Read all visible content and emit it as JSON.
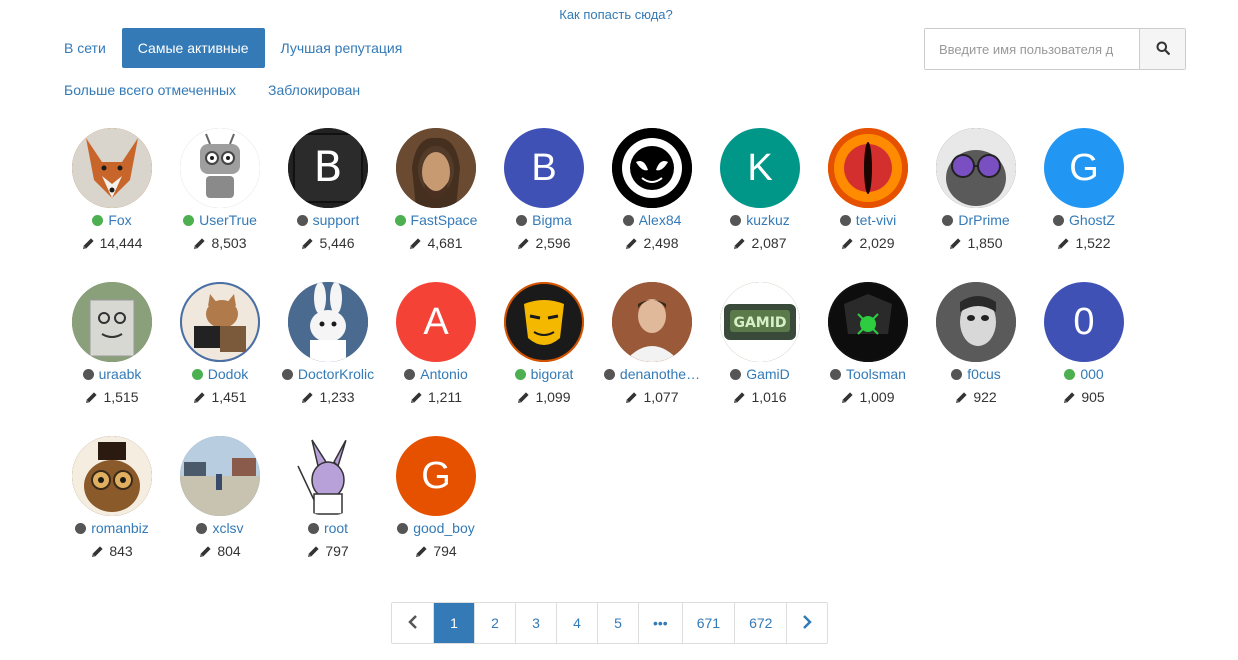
{
  "help_link": "Как попасть сюда?",
  "tabs": [
    {
      "label": "В сети",
      "active": false
    },
    {
      "label": "Самые активные",
      "active": true
    },
    {
      "label": "Лучшая репутация",
      "active": false
    },
    {
      "label": "Больше всего отмеченных",
      "active": false
    },
    {
      "label": "Заблокирован",
      "active": false
    }
  ],
  "search": {
    "placeholder": "Введите имя пользователя д"
  },
  "users": [
    {
      "name": "Fox",
      "online": true,
      "posts": "14,444",
      "avatar": {
        "type": "image",
        "icon": "fox-avatar",
        "color": "#b86a3a"
      }
    },
    {
      "name": "UserTrue",
      "online": true,
      "posts": "8,503",
      "avatar": {
        "type": "image",
        "icon": "robot-avatar",
        "color": "#9e9e9e"
      }
    },
    {
      "name": "support",
      "online": false,
      "posts": "5,446",
      "avatar": {
        "type": "image",
        "icon": "letter-b-avatar",
        "color": "#222222"
      }
    },
    {
      "name": "FastSpace",
      "online": true,
      "posts": "4,681",
      "avatar": {
        "type": "image",
        "icon": "portrait-avatar",
        "color": "#6b4a32"
      }
    },
    {
      "name": "Bigma",
      "online": false,
      "posts": "2,596",
      "avatar": {
        "type": "letter",
        "letter": "B",
        "color": "#3f51b5"
      }
    },
    {
      "name": "Alex84",
      "online": false,
      "posts": "2,498",
      "avatar": {
        "type": "image",
        "icon": "mask-avatar",
        "color": "#000000"
      }
    },
    {
      "name": "kuzkuz",
      "online": false,
      "posts": "2,087",
      "avatar": {
        "type": "letter",
        "letter": "K",
        "color": "#009688"
      }
    },
    {
      "name": "tet-vivi",
      "online": false,
      "posts": "2,029",
      "avatar": {
        "type": "image",
        "icon": "eye-avatar",
        "color": "#e65100"
      }
    },
    {
      "name": "DrPrime",
      "online": false,
      "posts": "1,850",
      "avatar": {
        "type": "image",
        "icon": "cat-avatar",
        "color": "#6d6d6d"
      }
    },
    {
      "name": "GhostZ",
      "online": false,
      "posts": "1,522",
      "avatar": {
        "type": "letter",
        "letter": "G",
        "color": "#2196f3"
      }
    },
    {
      "name": "uraabk",
      "online": false,
      "posts": "1,515",
      "avatar": {
        "type": "image",
        "icon": "box-avatar",
        "color": "#8a8a7a"
      }
    },
    {
      "name": "Dodok",
      "online": true,
      "posts": "1,451",
      "avatar": {
        "type": "image",
        "icon": "cat-laptop-avatar",
        "color": "#4a6fa5"
      }
    },
    {
      "name": "DoctorKrolic",
      "online": false,
      "posts": "1,233",
      "avatar": {
        "type": "image",
        "icon": "rabbit-avatar",
        "color": "#5a7aa0"
      }
    },
    {
      "name": "Antonio",
      "online": false,
      "posts": "1,211",
      "avatar": {
        "type": "letter",
        "letter": "A",
        "color": "#f44336"
      }
    },
    {
      "name": "bigorat",
      "online": true,
      "posts": "1,099",
      "avatar": {
        "type": "image",
        "icon": "anonymous-avatar",
        "color": "#d35400"
      }
    },
    {
      "name": "denanothe…",
      "online": false,
      "posts": "1,077",
      "avatar": {
        "type": "image",
        "icon": "photo-avatar",
        "color": "#a0522d"
      }
    },
    {
      "name": "GamiD",
      "online": false,
      "posts": "1,016",
      "avatar": {
        "type": "image",
        "icon": "gamid-avatar",
        "color": "#4a7a3a"
      }
    },
    {
      "name": "Toolsman",
      "online": false,
      "posts": "1,009",
      "avatar": {
        "type": "image",
        "icon": "skull-avatar",
        "color": "#111111"
      }
    },
    {
      "name": "f0cus",
      "online": false,
      "posts": "922",
      "avatar": {
        "type": "image",
        "icon": "mask-face-avatar",
        "color": "#7a7a7a"
      }
    },
    {
      "name": "000",
      "online": true,
      "posts": "905",
      "avatar": {
        "type": "letter",
        "letter": "0",
        "color": "#3f51b5"
      }
    },
    {
      "name": "romanbiz",
      "online": false,
      "posts": "843",
      "avatar": {
        "type": "image",
        "icon": "owl-avatar",
        "color": "#7a5a32"
      }
    },
    {
      "name": "xclsv",
      "online": false,
      "posts": "804",
      "avatar": {
        "type": "image",
        "icon": "street-avatar",
        "color": "#8aa0b5"
      }
    },
    {
      "name": "root",
      "online": false,
      "posts": "797",
      "avatar": {
        "type": "image",
        "icon": "rabbit-cartoon-avatar",
        "color": "#ffffff"
      }
    },
    {
      "name": "good_boy",
      "online": false,
      "posts": "794",
      "avatar": {
        "type": "letter",
        "letter": "G",
        "color": "#e65100"
      }
    }
  ],
  "pagination": {
    "pages": [
      "1",
      "2",
      "3",
      "4",
      "5",
      "•••",
      "671",
      "672"
    ],
    "active": "1",
    "prev_icon": "chevron-left-icon",
    "next_icon": "chevron-right-icon"
  },
  "colors": {
    "accent": "#337ab7",
    "online": "#4caf50",
    "offline": "#555555"
  }
}
